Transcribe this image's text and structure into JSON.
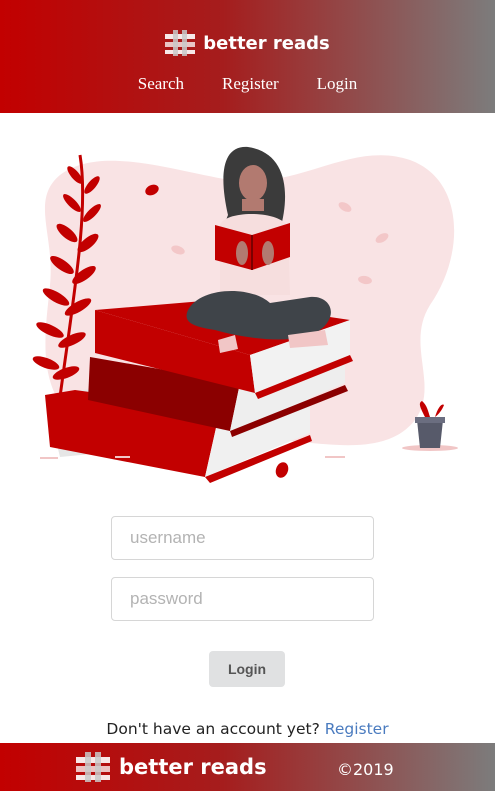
{
  "header": {
    "brand": "better reads",
    "nav": [
      {
        "label": "Search"
      },
      {
        "label": "Register"
      },
      {
        "label": "Login"
      }
    ]
  },
  "illustration": {
    "icon": "woman-reading-on-books-illustration"
  },
  "form": {
    "username_placeholder": "username",
    "password_placeholder": "password",
    "login_label": "Login"
  },
  "signup": {
    "prompt": "Don't have an account yet?",
    "link": "Register"
  },
  "footer": {
    "brand": "better reads",
    "copyright": "©2019"
  },
  "colors": {
    "brand_red": "#c20000",
    "gradient_end": "#7c7c7c",
    "link_blue": "#4a7bbf",
    "button_grey": "#e0e1e2"
  }
}
